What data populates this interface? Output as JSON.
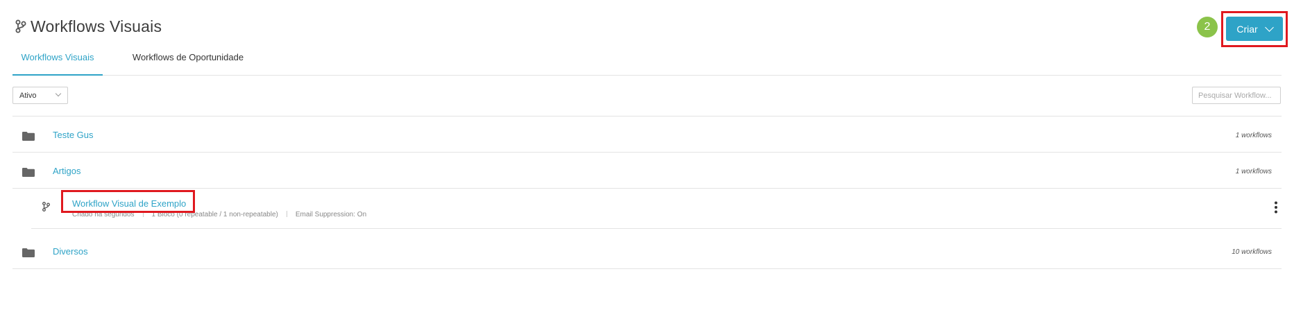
{
  "header": {
    "title": "Workflows Visuais",
    "step_badge": "2",
    "create_label": "Criar"
  },
  "tabs": [
    {
      "label": "Workflows Visuais",
      "active": true
    },
    {
      "label": "Workflows de Oportunidade",
      "active": false
    }
  ],
  "filters": {
    "status_value": "Ativo",
    "search_placeholder": "Pesquisar Workflow..."
  },
  "folders": [
    {
      "name": "Teste Gus",
      "count": "1 workflows"
    },
    {
      "name": "Artigos",
      "count": "1 workflows"
    },
    {
      "name": "Diversos",
      "count": "10 workflows"
    }
  ],
  "workflow": {
    "name": "Workflow Visual de Exemplo",
    "created": "Criado há segundos",
    "blocks": "1 Bloco  (0 repeatable / 1 non-repeatable)",
    "email_suppression": "Email Suppression: On"
  },
  "colors": {
    "accent": "#2ea3c7",
    "badge": "#8bc34a",
    "highlight": "#e0191f"
  },
  "icons": {
    "title": "workflow-branch-icon",
    "folder": "folder-icon",
    "workflow": "workflow-branch-icon",
    "menu": "kebab-menu-icon"
  }
}
